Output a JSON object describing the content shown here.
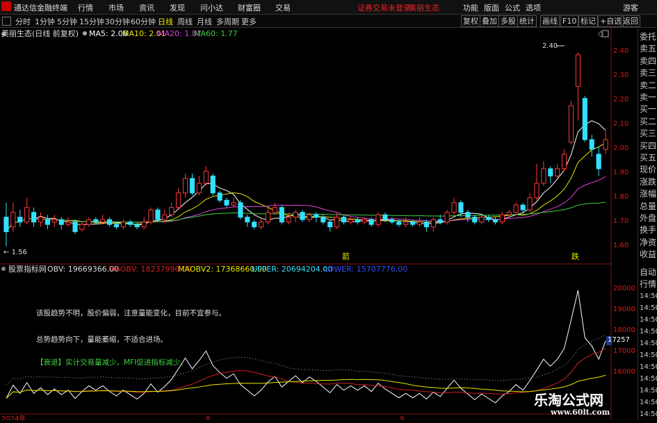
{
  "titlebar": {
    "app": "通达信金融终端",
    "menus": [
      "行情",
      "市场",
      "资讯",
      "发现",
      "问小达",
      "财富圈",
      "交易"
    ],
    "status1": "证券交易未登录",
    "status2": "美丽生态",
    "right": [
      "功能",
      "版面",
      "公式",
      "选项"
    ],
    "account": "游客"
  },
  "toolbar": {
    "periods": [
      "分时",
      "1分钟",
      "5分钟",
      "15分钟",
      "30分钟",
      "60分钟",
      "日线",
      "周线",
      "月线",
      "多周期",
      "更多"
    ],
    "right": [
      "复权",
      "叠加",
      "多股",
      "统计",
      "画线",
      "F10",
      "标记",
      "+自选",
      "返回"
    ]
  },
  "main": {
    "stock": "美丽生态(日线 前复权)",
    "ma5": "MA5: 2.06",
    "ma10": "MA10: 2.01",
    "ma20": "MA20: 1.87",
    "ma60": "MA60: 1.77",
    "high_label": "2.40",
    "low_label": "1.56",
    "price_ticks": [
      "2.40",
      "2.30",
      "2.20",
      "2.10",
      "2.00",
      "1.90",
      "1.80",
      "1.70",
      "1.60"
    ],
    "marker1": "箭",
    "marker2": "跌"
  },
  "indicator": {
    "name": "股票指标网",
    "obv": "OBV: 19669366.00",
    "maobv": "MAOBV: 18237990.00",
    "maobv2": "MAOBV2: 17368660.00",
    "upper": "UPPER: 20694204.00",
    "lower": "LOWER: 15707776.00",
    "note1": "该股趋势不明，股价偏弱，注意量能变化，目前不宜参与。",
    "note2": "总势趋势向下，量能萎缩，不适合进场。",
    "note3": "【衰退】实计交易量减少，MFI促进指标减少。",
    "vol_ticks": [
      "20000",
      "19000",
      "18000",
      "17000",
      "16000"
    ],
    "current": "17257"
  },
  "xaxis": {
    "start": "2024年",
    "m8": "8",
    "m9": "9"
  },
  "right_panel": [
    "委托",
    "卖五",
    "卖四",
    "卖三",
    "卖二",
    "卖一",
    "买一",
    "买二",
    "买三",
    "买四",
    "买五",
    "现价",
    "涨跌",
    "涨幅",
    "总量",
    "外盘",
    "换手",
    "净资",
    "收益"
  ],
  "right_panel2": [
    "自动",
    "行情",
    "14:50",
    "14:50",
    "14:50",
    "14:50",
    "14:50",
    "14:50",
    "14:50",
    "14:50",
    "14:50",
    "14:50",
    "14:50"
  ],
  "watermark": {
    "line1": "乐淘公式网",
    "line2": "www.60lt.com"
  },
  "colors": {
    "up": "#ff3b3b",
    "down": "#33e0ff",
    "ma5": "#ffffff",
    "ma10": "#e8e800",
    "ma20": "#e040e0",
    "ma60": "#40d040"
  },
  "chart_data": {
    "type": "candlestick",
    "ylim": [
      1.55,
      2.45
    ],
    "candles": [
      {
        "o": 1.72,
        "c": 1.66,
        "h": 1.78,
        "l": 1.6
      },
      {
        "o": 1.68,
        "c": 1.74,
        "h": 1.78,
        "l": 1.66
      },
      {
        "o": 1.72,
        "c": 1.7,
        "h": 1.75,
        "l": 1.68
      },
      {
        "o": 1.7,
        "c": 1.76,
        "h": 1.8,
        "l": 1.69
      },
      {
        "o": 1.74,
        "c": 1.7,
        "h": 1.76,
        "l": 1.68
      },
      {
        "o": 1.7,
        "c": 1.72,
        "h": 1.74,
        "l": 1.68
      },
      {
        "o": 1.71,
        "c": 1.69,
        "h": 1.73,
        "l": 1.67
      },
      {
        "o": 1.7,
        "c": 1.71,
        "h": 1.73,
        "l": 1.68
      },
      {
        "o": 1.71,
        "c": 1.69,
        "h": 1.72,
        "l": 1.67
      },
      {
        "o": 1.69,
        "c": 1.7,
        "h": 1.72,
        "l": 1.68
      },
      {
        "o": 1.7,
        "c": 1.66,
        "h": 1.71,
        "l": 1.65
      },
      {
        "o": 1.67,
        "c": 1.69,
        "h": 1.7,
        "l": 1.66
      },
      {
        "o": 1.69,
        "c": 1.71,
        "h": 1.72,
        "l": 1.68
      },
      {
        "o": 1.71,
        "c": 1.7,
        "h": 1.72,
        "l": 1.69
      },
      {
        "o": 1.7,
        "c": 1.71,
        "h": 1.73,
        "l": 1.69
      },
      {
        "o": 1.71,
        "c": 1.69,
        "h": 1.72,
        "l": 1.68
      },
      {
        "o": 1.69,
        "c": 1.68,
        "h": 1.7,
        "l": 1.67
      },
      {
        "o": 1.68,
        "c": 1.7,
        "h": 1.71,
        "l": 1.67
      },
      {
        "o": 1.7,
        "c": 1.69,
        "h": 1.71,
        "l": 1.68
      },
      {
        "o": 1.69,
        "c": 1.68,
        "h": 1.7,
        "l": 1.67
      },
      {
        "o": 1.68,
        "c": 1.7,
        "h": 1.72,
        "l": 1.67
      },
      {
        "o": 1.7,
        "c": 1.75,
        "h": 1.76,
        "l": 1.69
      },
      {
        "o": 1.75,
        "c": 1.71,
        "h": 1.76,
        "l": 1.7
      },
      {
        "o": 1.71,
        "c": 1.73,
        "h": 1.75,
        "l": 1.7
      },
      {
        "o": 1.73,
        "c": 1.76,
        "h": 1.78,
        "l": 1.72
      },
      {
        "o": 1.76,
        "c": 1.82,
        "h": 1.84,
        "l": 1.75
      },
      {
        "o": 1.82,
        "c": 1.88,
        "h": 1.9,
        "l": 1.8
      },
      {
        "o": 1.88,
        "c": 1.82,
        "h": 1.9,
        "l": 1.81
      },
      {
        "o": 1.82,
        "c": 1.86,
        "h": 1.89,
        "l": 1.81
      },
      {
        "o": 1.86,
        "c": 1.91,
        "h": 1.93,
        "l": 1.85
      },
      {
        "o": 1.89,
        "c": 1.82,
        "h": 1.9,
        "l": 1.81
      },
      {
        "o": 1.82,
        "c": 1.79,
        "h": 1.83,
        "l": 1.78
      },
      {
        "o": 1.79,
        "c": 1.77,
        "h": 1.8,
        "l": 1.76
      },
      {
        "o": 1.77,
        "c": 1.78,
        "h": 1.8,
        "l": 1.76
      },
      {
        "o": 1.78,
        "c": 1.72,
        "h": 1.79,
        "l": 1.71
      },
      {
        "o": 1.72,
        "c": 1.7,
        "h": 1.73,
        "l": 1.68
      },
      {
        "o": 1.7,
        "c": 1.68,
        "h": 1.71,
        "l": 1.67
      },
      {
        "o": 1.68,
        "c": 1.7,
        "h": 1.72,
        "l": 1.67
      },
      {
        "o": 1.7,
        "c": 1.74,
        "h": 1.76,
        "l": 1.69
      },
      {
        "o": 1.74,
        "c": 1.76,
        "h": 1.78,
        "l": 1.73
      },
      {
        "o": 1.76,
        "c": 1.7,
        "h": 1.77,
        "l": 1.69
      },
      {
        "o": 1.7,
        "c": 1.72,
        "h": 1.74,
        "l": 1.69
      },
      {
        "o": 1.72,
        "c": 1.74,
        "h": 1.75,
        "l": 1.7
      },
      {
        "o": 1.74,
        "c": 1.71,
        "h": 1.75,
        "l": 1.7
      },
      {
        "o": 1.71,
        "c": 1.73,
        "h": 1.74,
        "l": 1.7
      },
      {
        "o": 1.73,
        "c": 1.72,
        "h": 1.74,
        "l": 1.7
      },
      {
        "o": 1.72,
        "c": 1.7,
        "h": 1.73,
        "l": 1.69
      },
      {
        "o": 1.7,
        "c": 1.68,
        "h": 1.71,
        "l": 1.66
      },
      {
        "o": 1.68,
        "c": 1.72,
        "h": 1.74,
        "l": 1.67
      },
      {
        "o": 1.72,
        "c": 1.7,
        "h": 1.73,
        "l": 1.69
      },
      {
        "o": 1.7,
        "c": 1.71,
        "h": 1.72,
        "l": 1.69
      },
      {
        "o": 1.71,
        "c": 1.7,
        "h": 1.72,
        "l": 1.69
      },
      {
        "o": 1.7,
        "c": 1.71,
        "h": 1.72,
        "l": 1.69
      },
      {
        "o": 1.71,
        "c": 1.69,
        "h": 1.72,
        "l": 1.68
      },
      {
        "o": 1.69,
        "c": 1.73,
        "h": 1.74,
        "l": 1.68
      },
      {
        "o": 1.73,
        "c": 1.71,
        "h": 1.74,
        "l": 1.7
      },
      {
        "o": 1.71,
        "c": 1.7,
        "h": 1.72,
        "l": 1.69
      },
      {
        "o": 1.7,
        "c": 1.69,
        "h": 1.71,
        "l": 1.68
      },
      {
        "o": 1.69,
        "c": 1.7,
        "h": 1.72,
        "l": 1.68
      },
      {
        "o": 1.7,
        "c": 1.69,
        "h": 1.71,
        "l": 1.68
      },
      {
        "o": 1.69,
        "c": 1.7,
        "h": 1.72,
        "l": 1.68
      },
      {
        "o": 1.7,
        "c": 1.68,
        "h": 1.71,
        "l": 1.66
      },
      {
        "o": 1.68,
        "c": 1.71,
        "h": 1.72,
        "l": 1.66
      },
      {
        "o": 1.71,
        "c": 1.7,
        "h": 1.73,
        "l": 1.69
      },
      {
        "o": 1.7,
        "c": 1.74,
        "h": 1.75,
        "l": 1.69
      },
      {
        "o": 1.74,
        "c": 1.78,
        "h": 1.8,
        "l": 1.73
      },
      {
        "o": 1.78,
        "c": 1.74,
        "h": 1.79,
        "l": 1.72
      },
      {
        "o": 1.74,
        "c": 1.72,
        "h": 1.75,
        "l": 1.7
      },
      {
        "o": 1.72,
        "c": 1.7,
        "h": 1.73,
        "l": 1.69
      },
      {
        "o": 1.7,
        "c": 1.72,
        "h": 1.73,
        "l": 1.69
      },
      {
        "o": 1.72,
        "c": 1.71,
        "h": 1.73,
        "l": 1.7
      },
      {
        "o": 1.71,
        "c": 1.7,
        "h": 1.72,
        "l": 1.69
      },
      {
        "o": 1.7,
        "c": 1.73,
        "h": 1.74,
        "l": 1.69
      },
      {
        "o": 1.73,
        "c": 1.74,
        "h": 1.75,
        "l": 1.72
      },
      {
        "o": 1.74,
        "c": 1.77,
        "h": 1.78,
        "l": 1.73
      },
      {
        "o": 1.77,
        "c": 1.75,
        "h": 1.78,
        "l": 1.74
      },
      {
        "o": 1.75,
        "c": 1.8,
        "h": 1.82,
        "l": 1.74
      },
      {
        "o": 1.8,
        "c": 1.86,
        "h": 1.94,
        "l": 1.79
      },
      {
        "o": 1.86,
        "c": 1.92,
        "h": 1.95,
        "l": 1.85
      },
      {
        "o": 1.92,
        "c": 1.89,
        "h": 1.93,
        "l": 1.86
      },
      {
        "o": 1.89,
        "c": 1.92,
        "h": 1.94,
        "l": 1.88
      },
      {
        "o": 1.92,
        "c": 1.98,
        "h": 2.0,
        "l": 1.91
      },
      {
        "o": 2.03,
        "c": 2.18,
        "h": 2.2,
        "l": 2.02
      },
      {
        "o": 2.26,
        "c": 2.39,
        "h": 2.4,
        "l": 2.12
      },
      {
        "o": 2.21,
        "c": 2.04,
        "h": 2.22,
        "l": 2.03
      },
      {
        "o": 2.04,
        "c": 2.0,
        "h": 2.06,
        "l": 1.97
      },
      {
        "o": 1.98,
        "c": 1.92,
        "h": 2.01,
        "l": 1.89
      },
      {
        "o": 2.0,
        "c": 2.04,
        "h": 2.08,
        "l": 1.98
      }
    ]
  }
}
